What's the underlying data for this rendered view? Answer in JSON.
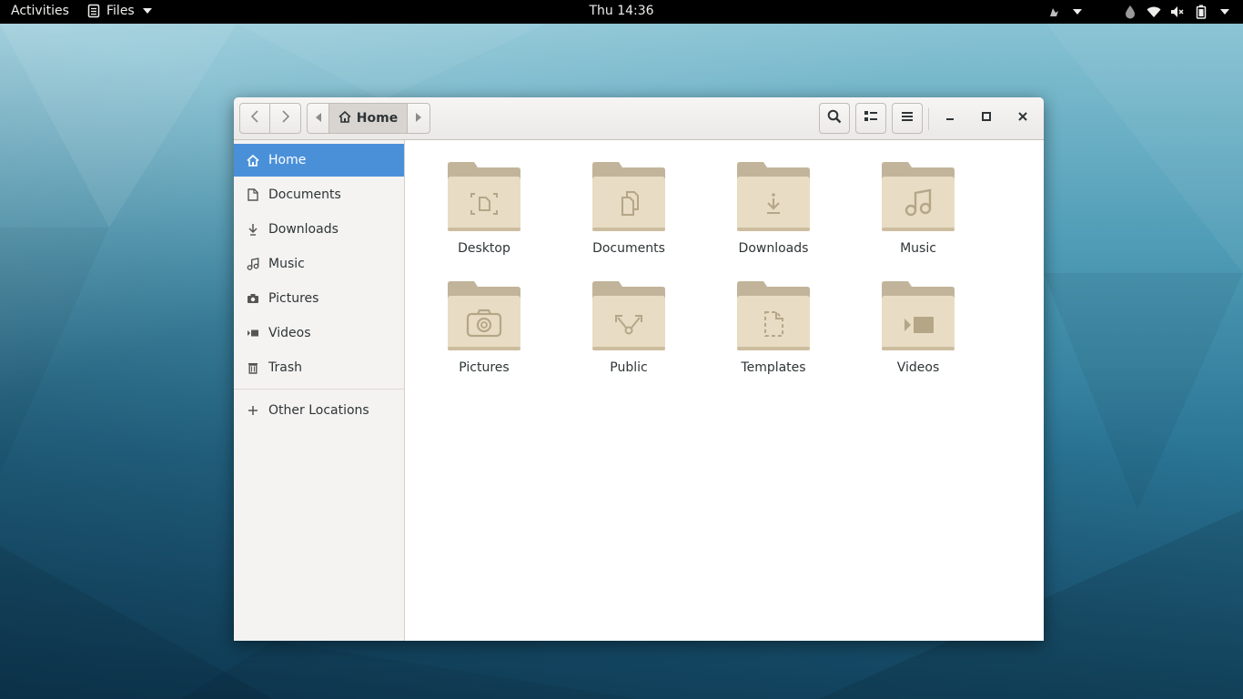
{
  "topbar": {
    "activities": "Activities",
    "app_name": "Files",
    "clock": "Thu 14:36",
    "indicators": [
      "user-accessibility-icon",
      "night-light-icon",
      "wifi-icon",
      "volume-muted-icon",
      "battery-icon"
    ]
  },
  "window": {
    "breadcrumb": {
      "current": "Home"
    },
    "buttons": [
      "back",
      "forward",
      "breadcrumb-left",
      "breadcrumb-right",
      "search",
      "view-toggle",
      "menu",
      "minimize",
      "maximize",
      "close"
    ]
  },
  "sidebar": {
    "items": [
      {
        "label": "Home",
        "icon": "home-icon",
        "active": true
      },
      {
        "label": "Documents",
        "icon": "document-icon"
      },
      {
        "label": "Downloads",
        "icon": "download-icon"
      },
      {
        "label": "Music",
        "icon": "music-icon"
      },
      {
        "label": "Pictures",
        "icon": "camera-icon"
      },
      {
        "label": "Videos",
        "icon": "video-icon"
      },
      {
        "label": "Trash",
        "icon": "trash-icon"
      }
    ],
    "other": {
      "label": "Other Locations",
      "icon": "plus-icon"
    }
  },
  "folders": [
    {
      "label": "Desktop",
      "icon": "desktop-emblem"
    },
    {
      "label": "Documents",
      "icon": "documents-emblem"
    },
    {
      "label": "Downloads",
      "icon": "download-emblem"
    },
    {
      "label": "Music",
      "icon": "music-emblem"
    },
    {
      "label": "Pictures",
      "icon": "camera-emblem"
    },
    {
      "label": "Public",
      "icon": "share-emblem"
    },
    {
      "label": "Templates",
      "icon": "template-emblem"
    },
    {
      "label": "Videos",
      "icon": "video-emblem"
    }
  ],
  "colors": {
    "accent": "#4a90d9",
    "folder_back": "#c2b49a",
    "folder_front": "#e9dcc4",
    "emblem": "#b5a688"
  }
}
